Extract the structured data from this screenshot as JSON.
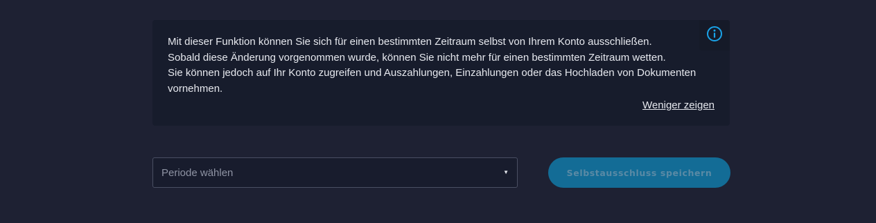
{
  "info_box": {
    "lines": [
      "Mit dieser Funktion können Sie sich für einen bestimmten Zeitraum selbst von Ihrem Konto ausschließen.",
      "Sobald diese Änderung vorgenommen wurde, können Sie nicht mehr für einen bestimmten Zeitraum wetten.",
      "Sie können jedoch auf Ihr Konto zugreifen und Auszahlungen, Einzahlungen oder das Hochladen von Dokumenten vornehmen."
    ],
    "toggle_label": "Weniger zeigen",
    "icon": "info-circle-icon",
    "icon_color": "#1aa3e8"
  },
  "period_select": {
    "placeholder": "Periode wählen",
    "caret_icon": "caret-down-icon"
  },
  "save_button": {
    "label": "Selbstausschluss speichern",
    "color": "#136c96"
  }
}
